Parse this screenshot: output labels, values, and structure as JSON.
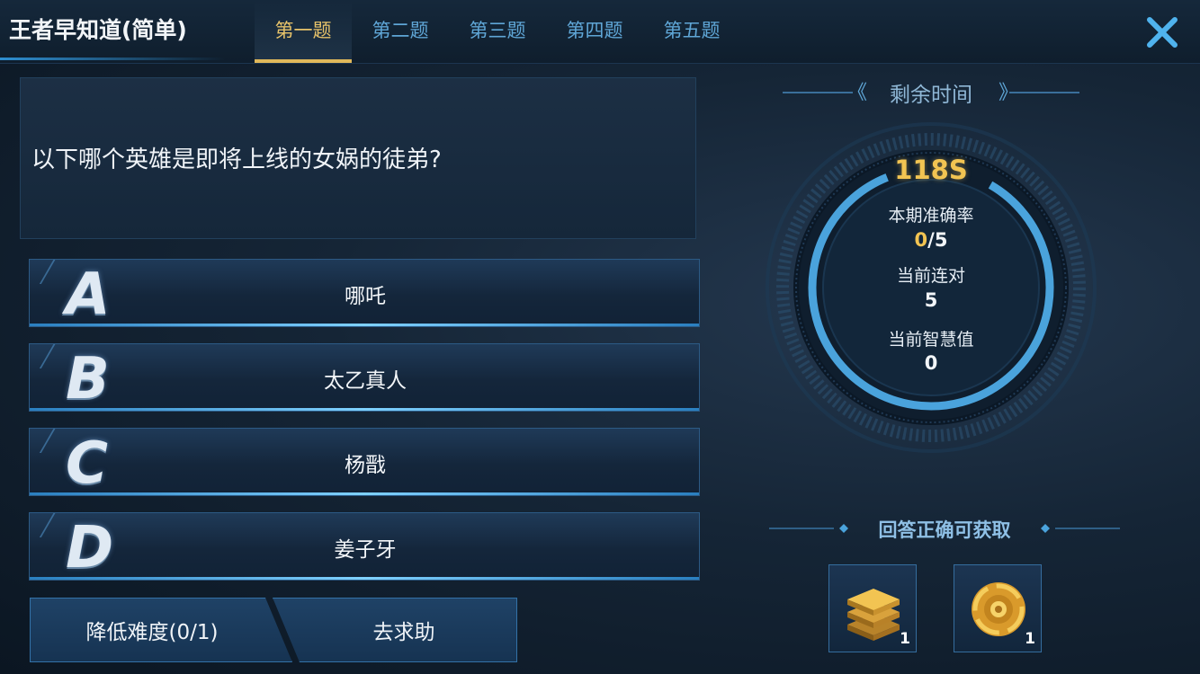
{
  "header": {
    "title": "王者早知道(简单)",
    "tabs": [
      {
        "label": "第一题",
        "active": true
      },
      {
        "label": "第二题",
        "active": false
      },
      {
        "label": "第三题",
        "active": false
      },
      {
        "label": "第四题",
        "active": false
      },
      {
        "label": "第五题",
        "active": false
      }
    ],
    "close_icon": "close-icon"
  },
  "question": {
    "text": "以下哪个英雄是即将上线的女娲的徒弟?"
  },
  "options": [
    {
      "letter": "A",
      "text": "哪吒"
    },
    {
      "letter": "B",
      "text": "太乙真人"
    },
    {
      "letter": "C",
      "text": "杨戬"
    },
    {
      "letter": "D",
      "text": "姜子牙"
    }
  ],
  "actions": {
    "lower_difficulty": "降低难度(0/1)",
    "ask_help": "去求助"
  },
  "timer": {
    "label": "剩余时间",
    "countdown": "118S"
  },
  "stats": {
    "accuracy_label": "本期准确率",
    "accuracy_correct": "0",
    "accuracy_total": "/5",
    "streak_label": "当前连对",
    "streak_value": "5",
    "wisdom_label": "当前智慧值",
    "wisdom_value": "0"
  },
  "rewards": {
    "label": "回答正确可获取",
    "items": [
      {
        "icon": "stacked-books-icon",
        "count": "1"
      },
      {
        "icon": "gold-coin-icon",
        "count": "1"
      }
    ]
  },
  "colors": {
    "accent_gold": "#f2c452",
    "accent_blue": "#4aa3dc",
    "tab_inactive": "#5fa6d6"
  }
}
